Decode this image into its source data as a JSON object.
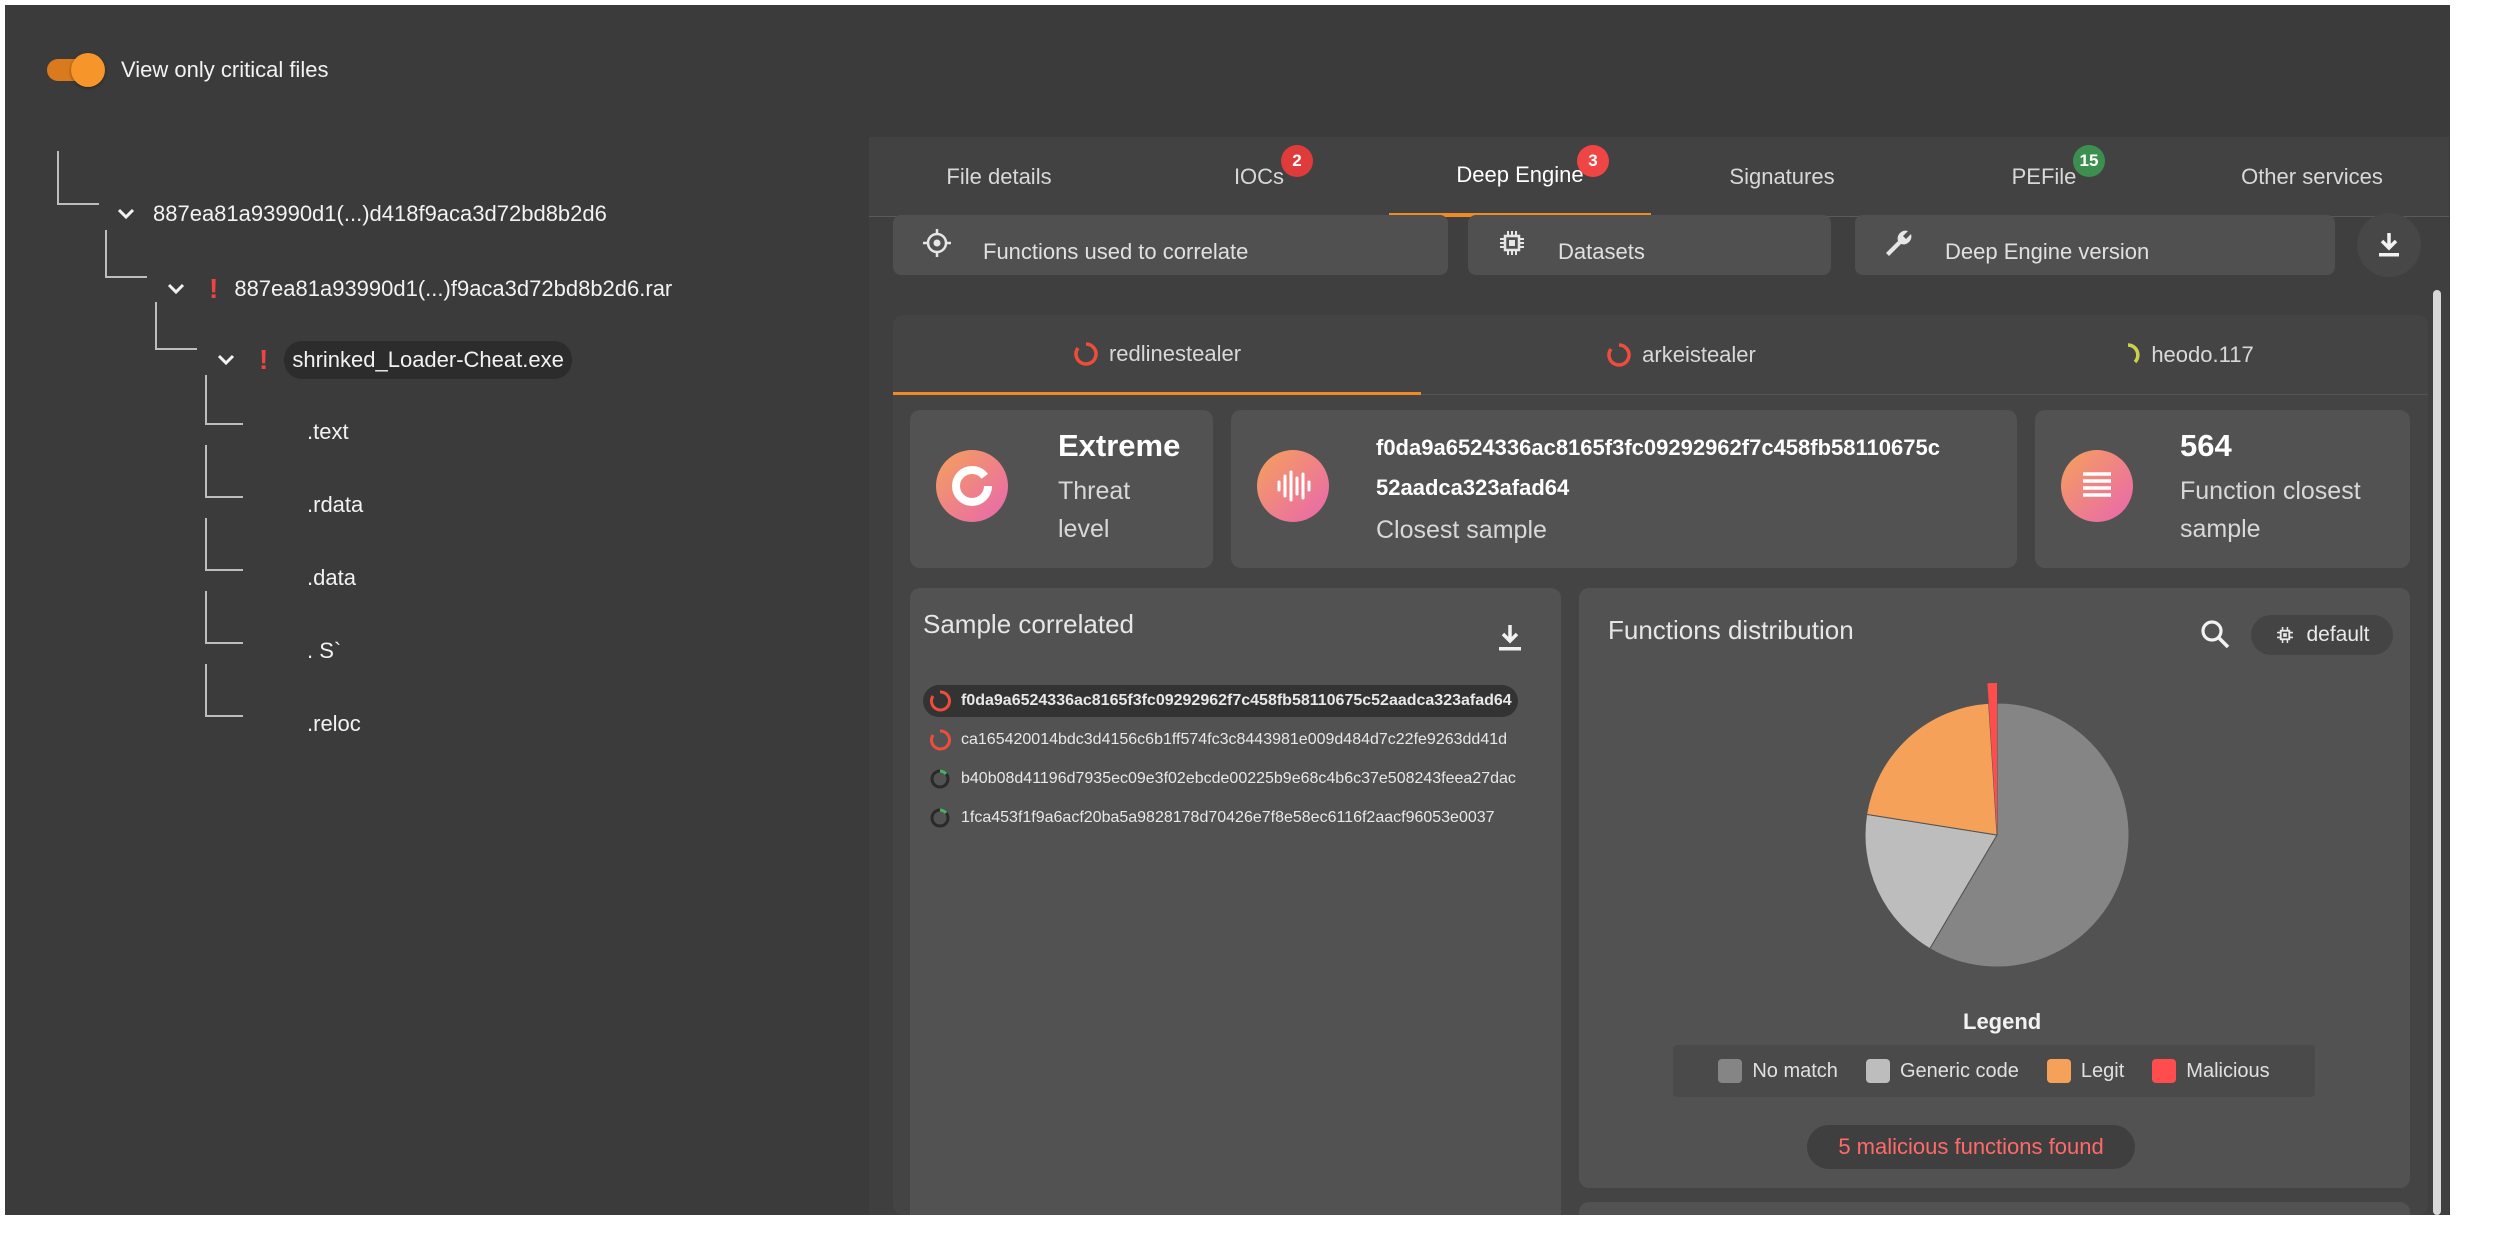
{
  "toggle": {
    "label": "View only critical files",
    "on": true
  },
  "tree": {
    "root": "887ea81a93990d1(...)d418f9aca3d72bd8b2d6",
    "archive": "887ea81a93990d1(...)f9aca3d72bd8b2d6.rar",
    "exe": "shrinked_Loader-Cheat.exe",
    "sections": [
      ".text",
      ".rdata",
      ".data",
      ". S`",
      ".reloc"
    ]
  },
  "tabs": [
    {
      "label": "File details"
    },
    {
      "label": "IOCs",
      "badge": "2"
    },
    {
      "label": "Deep Engine",
      "badge": "3"
    },
    {
      "label": "Signatures"
    },
    {
      "label": "PEFile",
      "badge": "15"
    },
    {
      "label": "Other services"
    }
  ],
  "stats": {
    "functions_label": "Functions used to correlate",
    "datasets_label": "Datasets",
    "engine_label": "Deep Engine version"
  },
  "families": [
    "redlinestealer",
    "arkeistealer",
    "heodo.117"
  ],
  "summary": {
    "threat_value": "Extreme",
    "threat_label_1": "Threat",
    "threat_label_2": "level",
    "closest_hash_1": "f0da9a6524336ac8165f3fc09292962f7c458fb58110675c",
    "closest_hash_2": "52aadca323afad64",
    "closest_label": "Closest sample",
    "function_count": "564",
    "function_label_1": "Function closest",
    "function_label_2": "sample"
  },
  "sample_correlated": {
    "title": "Sample correlated",
    "rows": [
      "f0da9a6524336ac8165f3fc09292962f7c458fb58110675c52aadca323afad64",
      "ca165420014bdc3d4156c6b1ff574fc3c8443981e009d484d7c22fe9263dd41d",
      "b40b08d41196d7935ec09e3f02ebcde00225b9e68c4b6c37e508243feea27dac",
      "1fca453f1f9a6acf20ba5a9828178d70426e7f8e58ec6116f2aacf96053e0037"
    ]
  },
  "distribution": {
    "title": "Functions distribution",
    "dataset_chip": "default",
    "legend_title": "Legend",
    "malicious_summary": "5 malicious functions found"
  },
  "chart_data": {
    "type": "pie",
    "title": "Functions distribution",
    "categories": [
      "No match",
      "Generic code",
      "Legit",
      "Malicious"
    ],
    "values": [
      58.5,
      19,
      21.5,
      1
    ],
    "colors": [
      "#858585",
      "#bdbdbd",
      "#f5a15a",
      "#ff4d4d"
    ]
  }
}
